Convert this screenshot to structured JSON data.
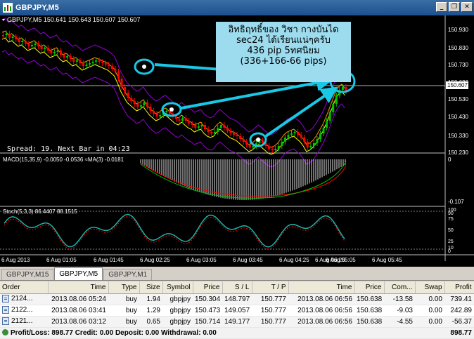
{
  "window": {
    "title": "GBPJPY,M5"
  },
  "chart": {
    "header": "GBPJPY,M5  150.641 150.643 150.607 150.607",
    "spread_text": "Spread: 19. Next Bar in 04:23",
    "macd_label": "MACD(15,35,9) -0.0050 -0.0536 ≈MA(3) -0.0181",
    "stoch_label": "Stoch(5,3,3) 86.4407 88.1515",
    "price_ticks": [
      "150.930",
      "150.830",
      "150.730",
      "150.630",
      "150.530",
      "150.430",
      "150.330",
      "150.230"
    ],
    "current_price": "150.607",
    "macd_ticks": [
      "0",
      "-0.107"
    ],
    "stoch_ticks": [
      "100",
      "90",
      "75",
      "50",
      "25",
      "10",
      "0"
    ],
    "time_ticks": [
      "6 Aug 2013",
      "6 Aug 01:05",
      "6 Aug 01:45",
      "6 Aug 02:25",
      "6 Aug 03:05",
      "6 Aug 03:45",
      "6 Aug 04:25",
      "6 Aug 05:05",
      "6 Aug 05:45",
      "6 Aug 06:25"
    ],
    "colors": {
      "bull": "#00c000",
      "bear": "#ff0000",
      "annotation_arrow": "#19c8e6",
      "bollinger": "#9400d3",
      "ma": "#ffff00"
    }
  },
  "annotation": {
    "line1": "อิทธิฤทธิ์ของ วิชา กางบันได",
    "line2": "sec24 ได้เรียนแน่ๆครับ",
    "line3": "436 pip 5ทศนิยม",
    "line4": "(336+166-66 pips)"
  },
  "tabs": [
    {
      "label": "GBPJPY,M15",
      "active": false
    },
    {
      "label": "GBPJPY,M5",
      "active": true
    },
    {
      "label": "GBPJPY,M1",
      "active": false
    }
  ],
  "terminal": {
    "columns": [
      "Order",
      "Time",
      "Type",
      "Size",
      "Symbol",
      "Price",
      "S / L",
      "T / P",
      "Time",
      "Price",
      "Com...",
      "Swap",
      "Profit"
    ],
    "rows": [
      [
        "2124...",
        "2013.08.06 05:24",
        "buy",
        "1.94",
        "gbpjpy",
        "150.304",
        "148.797",
        "150.777",
        "2013.08.06 06:56",
        "150.638",
        "-13.58",
        "0.00",
        "739.41"
      ],
      [
        "2122...",
        "2013.08.06 03:41",
        "buy",
        "1.29",
        "gbpjpy",
        "150.473",
        "149.057",
        "150.777",
        "2013.08.06 06:56",
        "150.638",
        "-9.03",
        "0.00",
        "242.89"
      ],
      [
        "2121...",
        "2013.08.06 03:12",
        "buy",
        "0.65",
        "gbpjpy",
        "150.714",
        "149.177",
        "150.777",
        "2013.08.06 06:56",
        "150.638",
        "-4.55",
        "0.00",
        "-56.37"
      ]
    ],
    "summary": {
      "text": "Profit/Loss: 898.77  Credit: 0.00  Deposit: 0.00  Withdrawal: 0.00",
      "total": "898.77"
    }
  }
}
